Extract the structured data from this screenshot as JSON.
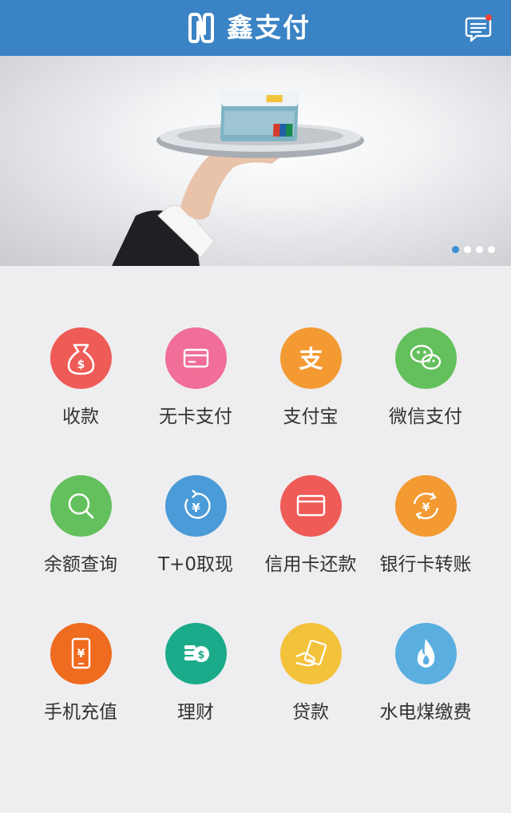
{
  "header": {
    "title": "鑫支付",
    "logo_icon": "n-logo-icon",
    "message_icon": "message-icon",
    "background_color": "#3a83c4",
    "notification_dot_color": "#e8453c"
  },
  "banner": {
    "image": "hand-holding-tray-with-bank-card",
    "slide_count": 4,
    "active_slide": 1,
    "active_dot_color": "#3a8fd4"
  },
  "services": [
    {
      "label": "收款",
      "icon": "money-bag-icon",
      "color": "#ef5b57"
    },
    {
      "label": "无卡支付",
      "icon": "card-icon",
      "color": "#f06e97"
    },
    {
      "label": "支付宝",
      "icon": "alipay-icon",
      "color": "#f39a32"
    },
    {
      "label": "微信支付",
      "icon": "wechat-icon",
      "color": "#63c05c"
    },
    {
      "label": "余额查询",
      "icon": "search-icon",
      "color": "#63c05c"
    },
    {
      "label": "T+0取现",
      "icon": "yen-refresh-icon",
      "color": "#4a9bd7"
    },
    {
      "label": "信用卡还款",
      "icon": "credit-card-icon",
      "color": "#ef5b57"
    },
    {
      "label": "银行卡转账",
      "icon": "yen-transfer-icon",
      "color": "#f39a32"
    },
    {
      "label": "手机充值",
      "icon": "phone-yen-icon",
      "color": "#ef6b1f"
    },
    {
      "label": "理财",
      "icon": "coins-dollar-icon",
      "color": "#1cab8a"
    },
    {
      "label": "贷款",
      "icon": "loan-hand-icon",
      "color": "#f3c23b"
    },
    {
      "label": "水电煤缴费",
      "icon": "flame-icon",
      "color": "#5aaee0"
    }
  ]
}
